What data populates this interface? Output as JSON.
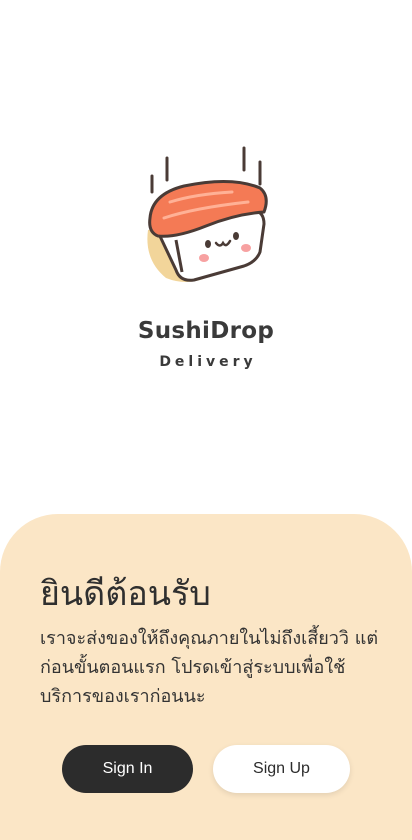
{
  "brand": {
    "logo_icon": "sushi-mascot-icon",
    "name": "SushiDrop",
    "tagline": "Delivery"
  },
  "welcome": {
    "title": "ยินดีต้อนรับ",
    "body": "เราจะส่งของให้ถึงคุณภายในไม่ถึงเสี้ยววิ แต่ก่อนขั้นตอนแรก โปรดเข้าสู่ระบบเพื่อใช้บริการของเราก่อนนะ",
    "panel_color": "#fbe6c6"
  },
  "actions": {
    "sign_in_label": "Sign In",
    "sign_up_label": "Sign Up"
  },
  "colors": {
    "dark": "#2c2c2c",
    "salmon": "#f47a55",
    "rice": "#ffffff"
  }
}
